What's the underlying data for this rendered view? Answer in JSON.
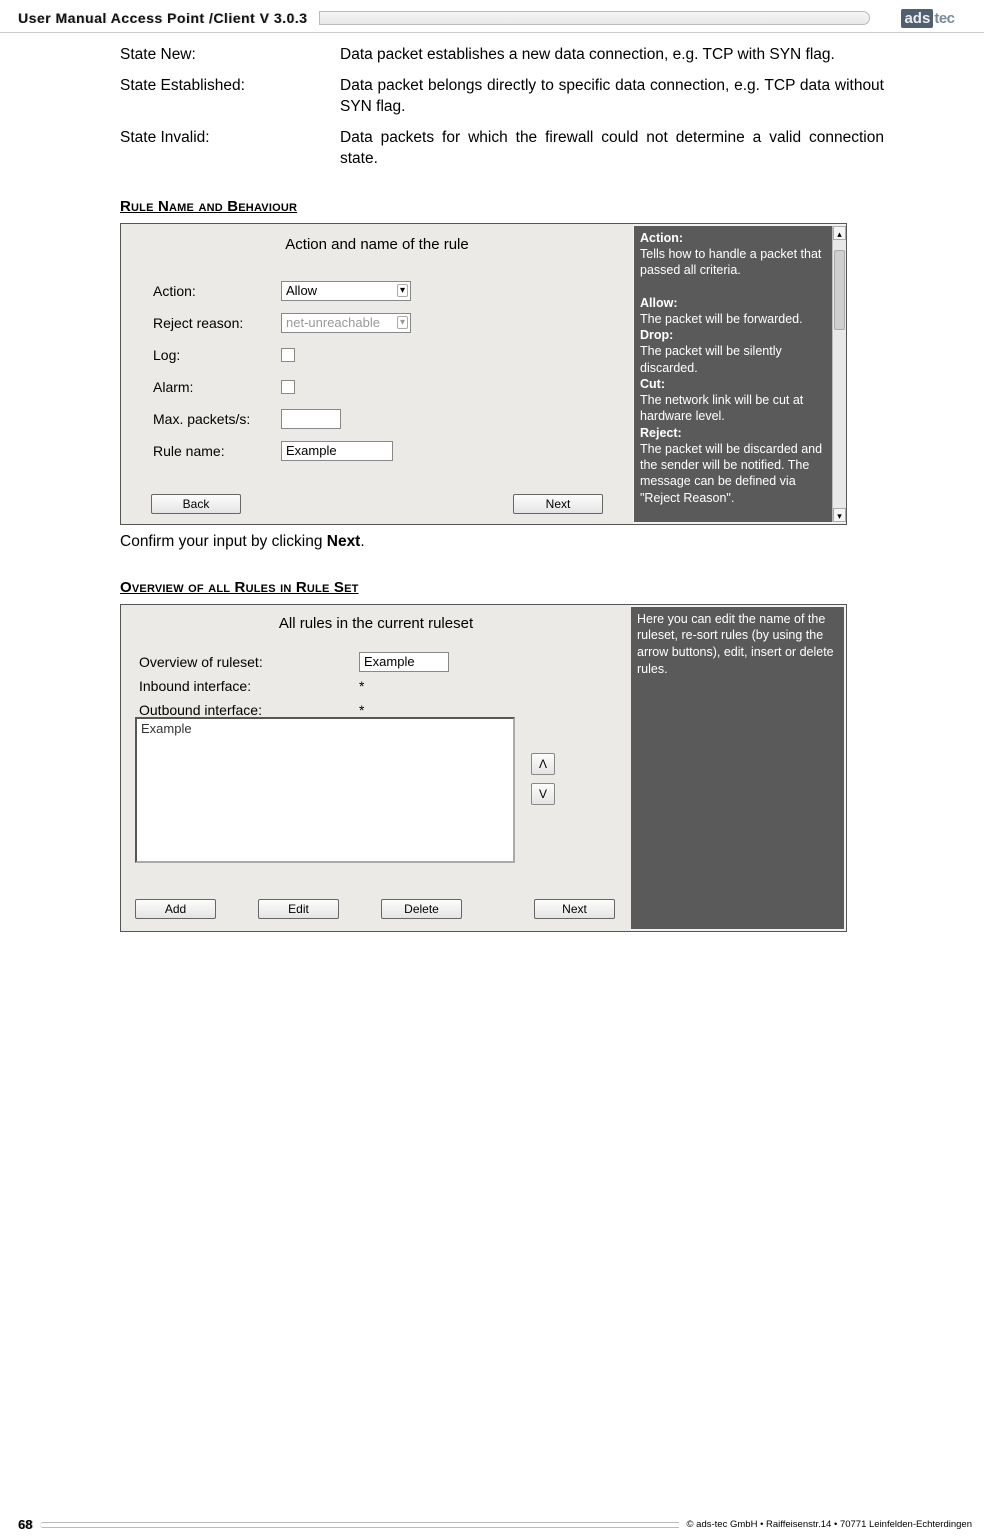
{
  "header": {
    "title": "User Manual Access Point /Client V 3.0.3",
    "logo_ads": "ads",
    "logo_tec": "tec"
  },
  "definitions": [
    {
      "term": "State New:",
      "desc": "Data packet establishes a new data connection, e.g. TCP with SYN flag."
    },
    {
      "term": "State Established:",
      "desc": "Data packet belongs directly to specific data connection, e.g. TCP data without SYN flag."
    },
    {
      "term": "State Invalid:",
      "desc": "Data packets for which the firewall could not determine a valid connection state."
    }
  ],
  "section1_heading": "Rule Name and Behaviour",
  "fig1": {
    "title": "Action and name of the rule",
    "labels": {
      "action": "Action:",
      "reject": "Reject reason:",
      "log": "Log:",
      "alarm": "Alarm:",
      "max": "Max. packets/s:",
      "rule": "Rule name:"
    },
    "action_value": "Allow",
    "reject_value": "net-unreachable",
    "rulename_value": "Example",
    "back": "Back",
    "next": "Next",
    "help": "Action:\nTells how to handle a packet that passed all criteria.\n\nAllow:\nThe packet will be forwarded.\nDrop:\nThe packet will be silently discarded.\nCut:\nThe network link will be cut at hardware level.\nReject:\nThe packet will be discarded and the sender will be notified. The message can be defined via \"Reject Reason\".\n\nAdditionally, a log entry could"
  },
  "mid_text_pre": "Confirm your input by clicking ",
  "mid_text_bold": "Next",
  "mid_text_post": ".",
  "section2_heading": "Overview of all Rules in Rule Set",
  "fig2": {
    "title": "All rules in the current ruleset",
    "labels": {
      "overview": "Overview of ruleset:",
      "inbound": "Inbound interface:",
      "outbound": "Outbound interface:"
    },
    "overview_value": "Example",
    "inbound_value": "*",
    "outbound_value": "*",
    "list_item": "Example",
    "up": "Λ",
    "down": "V",
    "add": "Add",
    "edit": "Edit",
    "delete": "Delete",
    "next": "Next",
    "help": "Here you can edit the name of the ruleset, re-sort rules (by using the arrow buttons), edit, insert or delete rules."
  },
  "footer": {
    "page": "68",
    "copy": "© ads-tec GmbH • Raiffeisenstr.14 • 70771 Leinfelden-Echterdingen"
  }
}
